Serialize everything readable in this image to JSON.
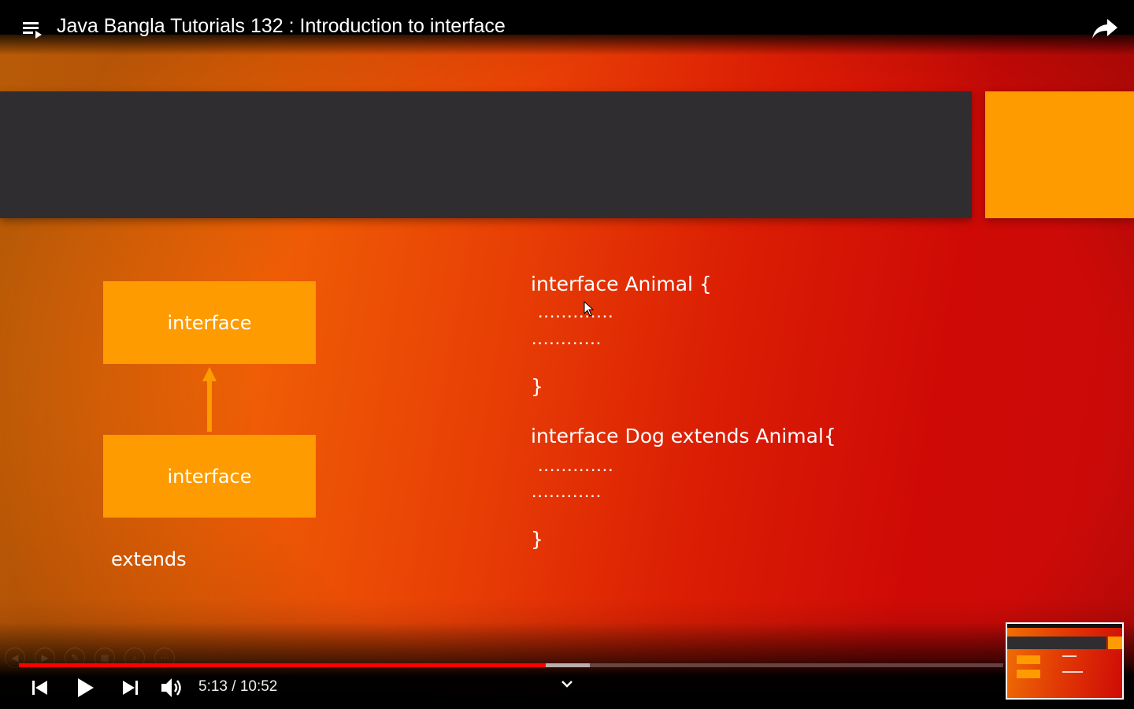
{
  "player": {
    "title": "Java Bangla Tutorials 132 : Introduction to interface",
    "time_display": "5:13 / 10:52",
    "progress_fraction": 0.535,
    "buffered_fraction": 0.58,
    "colors": {
      "progress": "#ff0000",
      "slide_orange": "#fd9b00",
      "slide_dark_band": "#2f2d2f"
    },
    "icons": {
      "playlist": "playlist-icon",
      "share": "share-icon",
      "previous": "skip-previous-icon",
      "play": "play-icon",
      "next": "skip-next-icon",
      "volume": "volume-icon",
      "expand": "chevron-down-icon"
    }
  },
  "slide": {
    "diagram": {
      "top_box": "interface",
      "bottom_box": "interface",
      "relation_label": "extends"
    },
    "code": {
      "line1": "interface Animal {",
      "dots_a": ".............",
      "dots_b": "............",
      "close1": "}",
      "line2": "interface Dog extends Animal{",
      "dots_c": ".............",
      "dots_d": "............",
      "close2": "}"
    },
    "presentation_controls": [
      "previous-slide-icon",
      "next-slide-icon",
      "pen-icon",
      "slides-grid-icon",
      "zoom-icon",
      "more-icon"
    ]
  }
}
